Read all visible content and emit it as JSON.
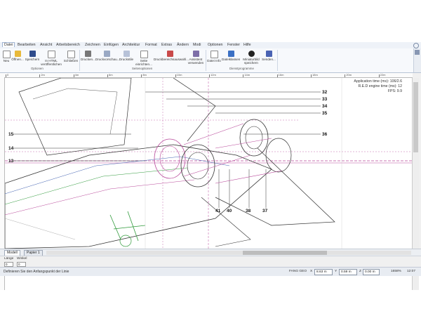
{
  "menu": [
    "Datei",
    "Bearbeiten",
    "Ansicht",
    "Arbeitsbereich",
    "Zeichnen",
    "Einfügen",
    "Architektur",
    "Format",
    "Extras",
    "Ändern",
    "Modi",
    "Optionen",
    "Fenster",
    "Hilfe"
  ],
  "ribbon": {
    "buttons": [
      "Neu",
      "Öffnen...",
      "Speichern",
      "In HTML veröffentlichen",
      "Schließen",
      "Drucken...",
      "Druckvorschau...",
      "Druckstile",
      "Seite einrichten...",
      "Druckbereichsauswahl...",
      "Assistent verwenden",
      "Datei Info",
      "Dateiklassen",
      "Miniaturbild speichern",
      "Senden..."
    ],
    "groups": [
      "Optionen",
      "Seitenoptionen",
      "Dienstprogramme"
    ],
    "side_tool": "Eigenschaften"
  },
  "ruler": {
    "labels": [
      "0",
      "2m",
      "4m",
      "6m",
      "8m",
      "10m",
      "12m",
      "14m",
      "16m",
      "18m",
      "20m",
      "22m"
    ]
  },
  "drawing": {
    "labels_left": [
      "15",
      "14",
      "13"
    ],
    "labels_right": [
      "32",
      "33",
      "34",
      "35",
      "36"
    ],
    "labels_bottom": [
      "41",
      "40",
      "38",
      "37"
    ],
    "perf": [
      "Application time (ms): 106/2.6",
      "R.E.D engine time (ms): 12",
      "FPS: 9.9"
    ]
  },
  "tabs": [
    "Modell",
    "Papier 1"
  ],
  "inputs": {
    "length_label": "Länge",
    "angle_label": "Winkel",
    "length_value": "0",
    "angle_value": "0"
  },
  "status": {
    "message": "Definieren Sie den Anfangspunkt der Linie",
    "modes": "FANG GEO",
    "x": "8.63 m",
    "y": "0.59 m",
    "z": "0.00 m",
    "zoom": "1658%",
    "time": "12:07"
  },
  "colors": {
    "magenta": "#b8489a",
    "green": "#2f9a3a",
    "blue": "#3f5fb0"
  }
}
